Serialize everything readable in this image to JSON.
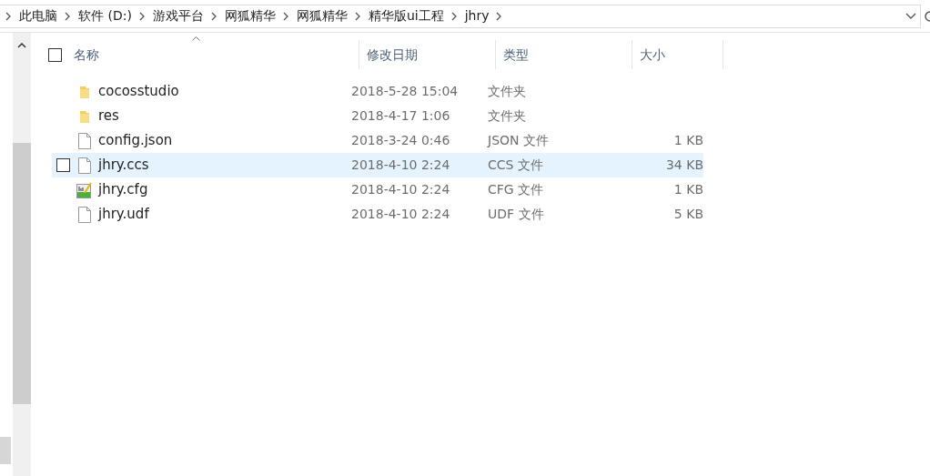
{
  "breadcrumb": [
    "此电脑",
    "软件 (D:)",
    "游戏平台",
    "网狐精华",
    "网狐精华",
    "精华版ui工程",
    "jhry"
  ],
  "select_all": {
    "checked": false
  },
  "columns": [
    "名称",
    "修改日期",
    "类型",
    "大小"
  ],
  "rows": [
    {
      "kind": "folder",
      "name": "cocosstudio",
      "modified": "2018-5-28 15:04",
      "type": "文件夹",
      "selected": false
    },
    {
      "kind": "folder",
      "name": "res",
      "modified": "2018-4-17 1:06",
      "type": "文件夹",
      "selected": false
    },
    {
      "kind": "file",
      "name": "config.json",
      "modified": "2018-3-24 0:46",
      "type": "JSON 文件",
      "size": "1 KB",
      "selected": false
    },
    {
      "kind": "file",
      "name": "jhry.ccs",
      "modified": "2018-4-10 2:24",
      "type": "CCS 文件",
      "size": "34 KB",
      "selected": true
    },
    {
      "kind": "config",
      "name": "jhry.cfg",
      "modified": "2018-4-10 2:24",
      "type": "CFG 文件",
      "size": "1 KB",
      "selected": false
    },
    {
      "kind": "file",
      "name": "jhry.udf",
      "modified": "2018-4-10 2:24",
      "type": "UDF 文件",
      "size": "5 KB",
      "selected": false
    }
  ]
}
